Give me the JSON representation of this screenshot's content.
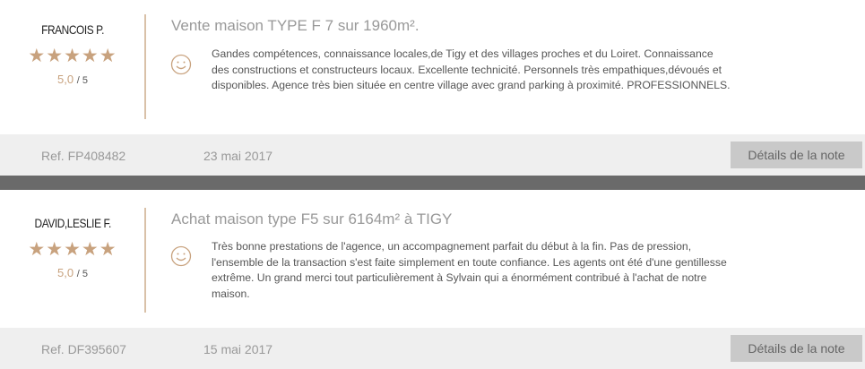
{
  "colors": {
    "accent": "#c8a27e",
    "separator": "#6a6a6a",
    "footer_bg": "#efefef",
    "button_bg": "#c9c9c9"
  },
  "reviews": [
    {
      "author": "FRANCOIS P.",
      "stars": "★★★★★",
      "rating": "5,0",
      "rating_suffix": "/ 5",
      "title": "Vente maison TYPE F 7 sur 1960m².",
      "sentiment_icon": "smiley-icon",
      "comment": "Gandes compétences, connaissance locales,de Tigy et des villages proches et du Loiret. Connaissance des constructions et constructeurs locaux. Excellente technicité. Personnels très empathiques,dévoués et disponibles. Agence très bien située en centre village avec grand parking à proximité. PROFESSIONNELS.",
      "ref": "Ref. FP408482",
      "date": "23 mai 2017",
      "details_label": "Détails de la note"
    },
    {
      "author": "DAVID,LESLIE F.",
      "stars": "★★★★★",
      "rating": "5,0",
      "rating_suffix": "/ 5",
      "title": "Achat maison type F5 sur 6164m² à TIGY",
      "sentiment_icon": "smiley-icon",
      "comment": "Très bonne prestations de l'agence, un accompagnement parfait du début à la fin. Pas de pression, l'ensemble de la transaction s'est faite simplement en toute confiance. Les agents ont été d'une gentillesse extrême. Un grand merci tout particulièrement à Sylvain qui a énormément contribué à l'achat de notre maison.",
      "ref": "Ref. DF395607",
      "date": "15 mai 2017",
      "details_label": "Détails de la note"
    }
  ]
}
